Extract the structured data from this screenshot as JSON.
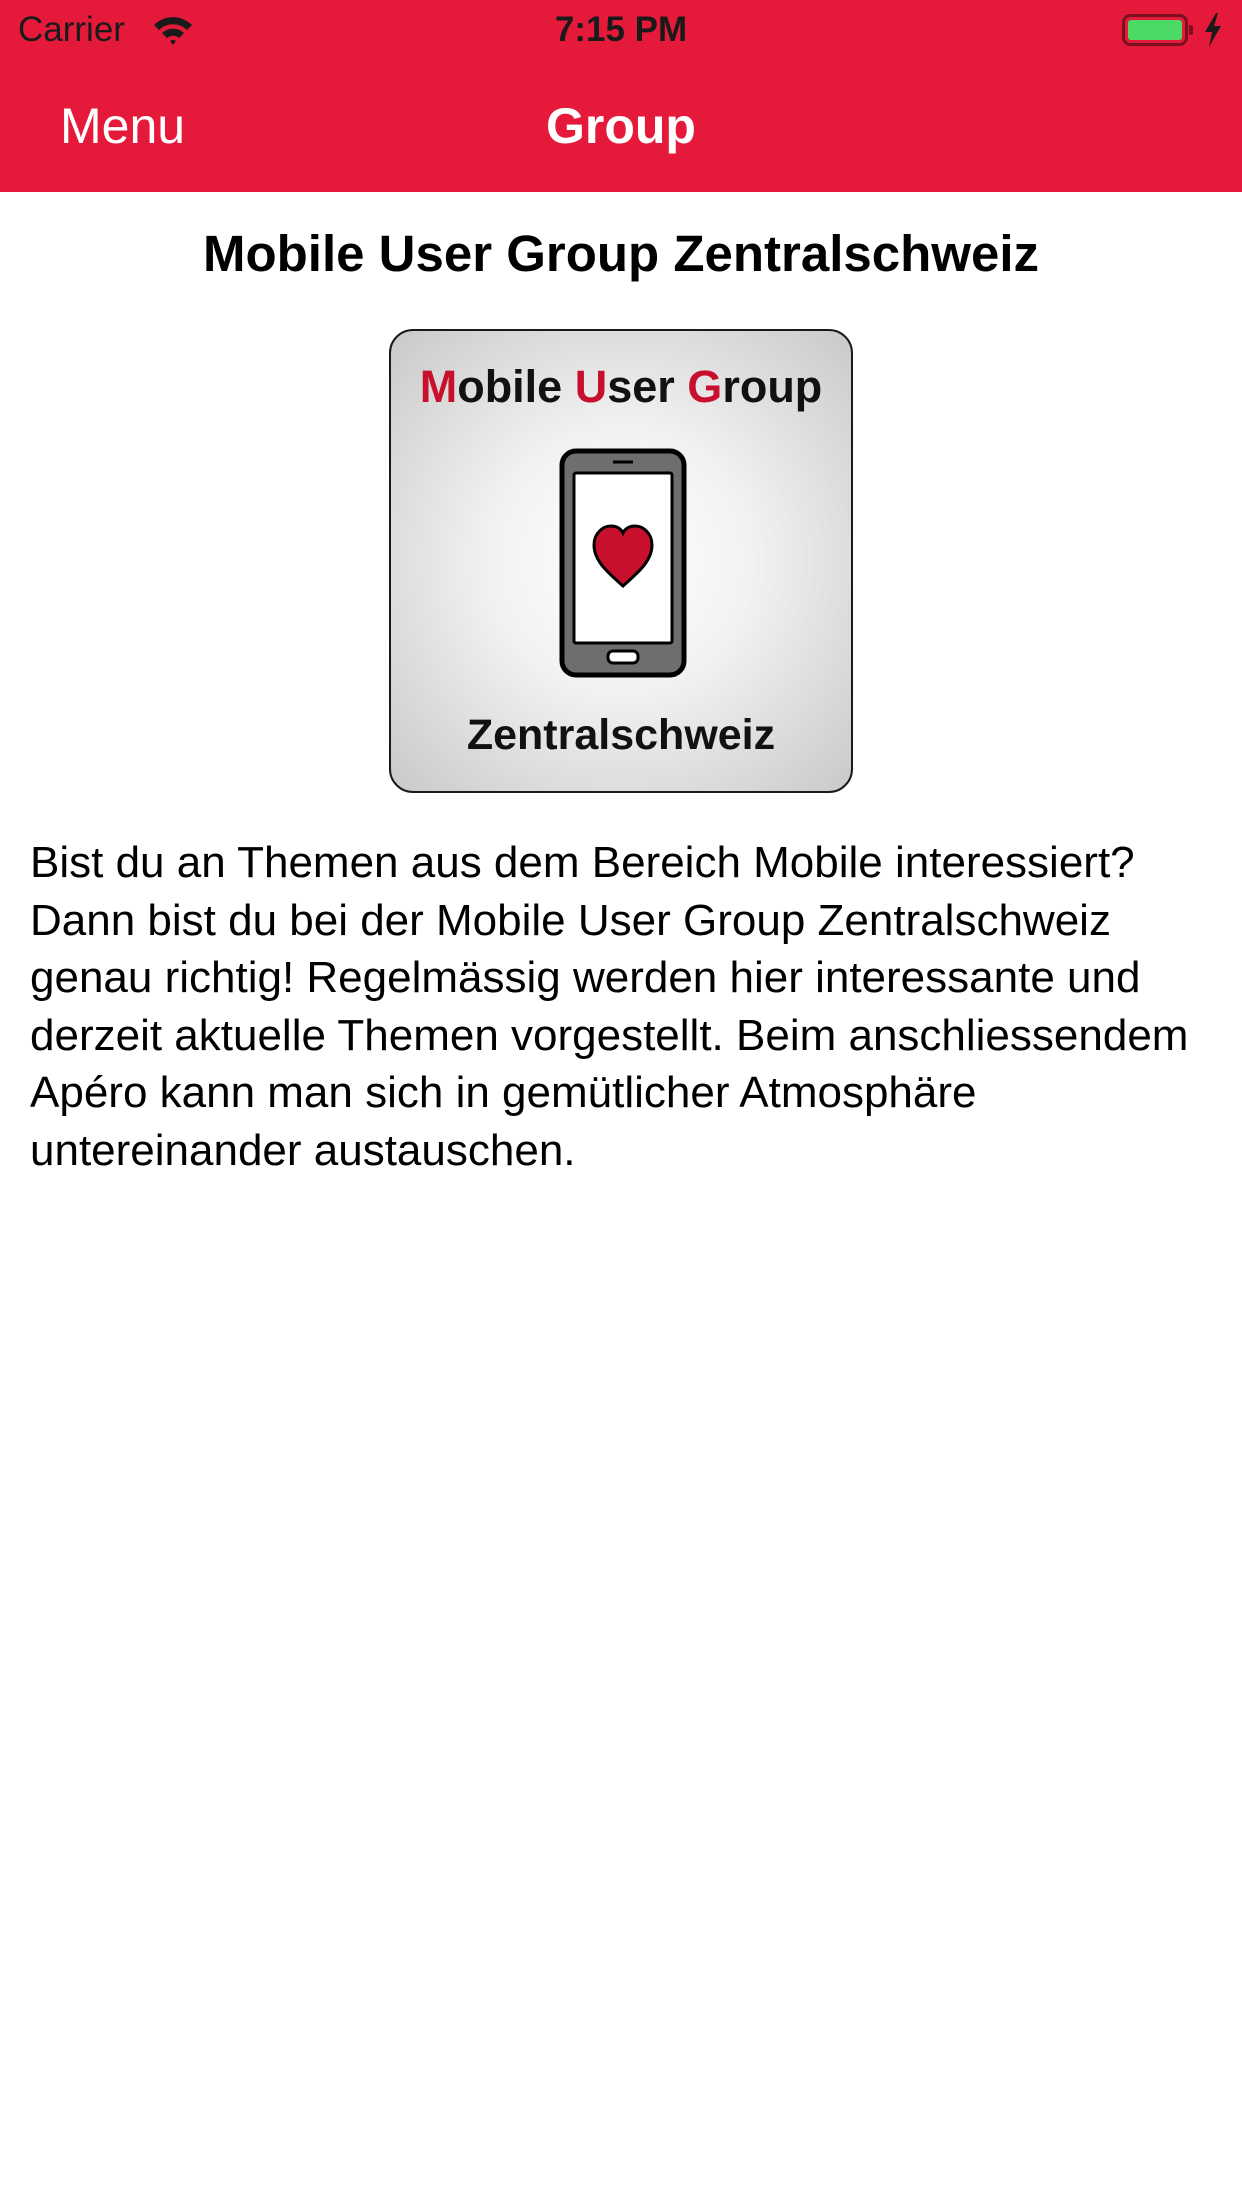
{
  "status_bar": {
    "carrier": "Carrier",
    "time": "7:15 PM",
    "icons": [
      "wifi-icon",
      "battery-icon",
      "charging-bolt-icon"
    ]
  },
  "nav": {
    "menu_label": "Menu",
    "title": "Group"
  },
  "group": {
    "name": "Mobile User Group Zentralschweiz",
    "logo": {
      "title_parts": [
        "M",
        "obile ",
        "U",
        "ser ",
        "G",
        "roup"
      ],
      "subtitle": "Zentralschweiz"
    },
    "description": "Bist du an Themen aus dem Bereich Mobile interessiert? Dann bist du bei der Mobile User Group Zentralschweiz genau richtig! Regelmässig werden hier interessante und derzeit aktuelle Themen vorgestellt. Beim anschliessendem Apéro kann man sich in gemütlicher Atmosphäre untereinander austauschen."
  },
  "colors": {
    "brand": "#e51a3b",
    "logo_accent": "#c8102e",
    "battery_fill": "#4cd964"
  }
}
